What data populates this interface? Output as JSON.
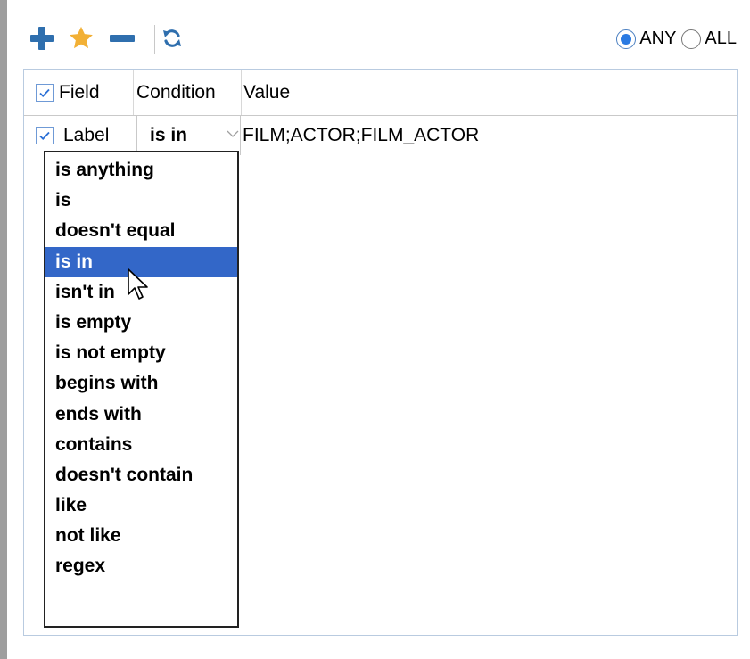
{
  "toolbar": {
    "add_icon": "plus-icon",
    "favorite_icon": "star-icon",
    "remove_icon": "minus-icon",
    "refresh_icon": "refresh-icon",
    "match_options": [
      {
        "label": "ANY",
        "checked": true
      },
      {
        "label": "ALL",
        "checked": false
      }
    ]
  },
  "table": {
    "headers": {
      "field": "Field",
      "condition": "Condition",
      "value": "Value"
    },
    "header_checked": true,
    "rows": [
      {
        "checked": true,
        "field": "Label",
        "condition": "is in",
        "value": "FILM;ACTOR;FILM_ACTOR"
      }
    ]
  },
  "condition_dropdown": {
    "open": true,
    "selected": "is in",
    "options": [
      "is anything",
      "is",
      "doesn't equal",
      "is in",
      "isn't in",
      "is empty",
      "is not empty",
      "begins with",
      "ends with",
      "contains",
      "doesn't contain",
      "like",
      "not like",
      "regex"
    ]
  },
  "colors": {
    "accent": "#2f6fae",
    "star": "#f2b035",
    "selection": "#3367c8",
    "radio_on": "#2a7ae2",
    "panel_border": "#b9cbe0"
  }
}
